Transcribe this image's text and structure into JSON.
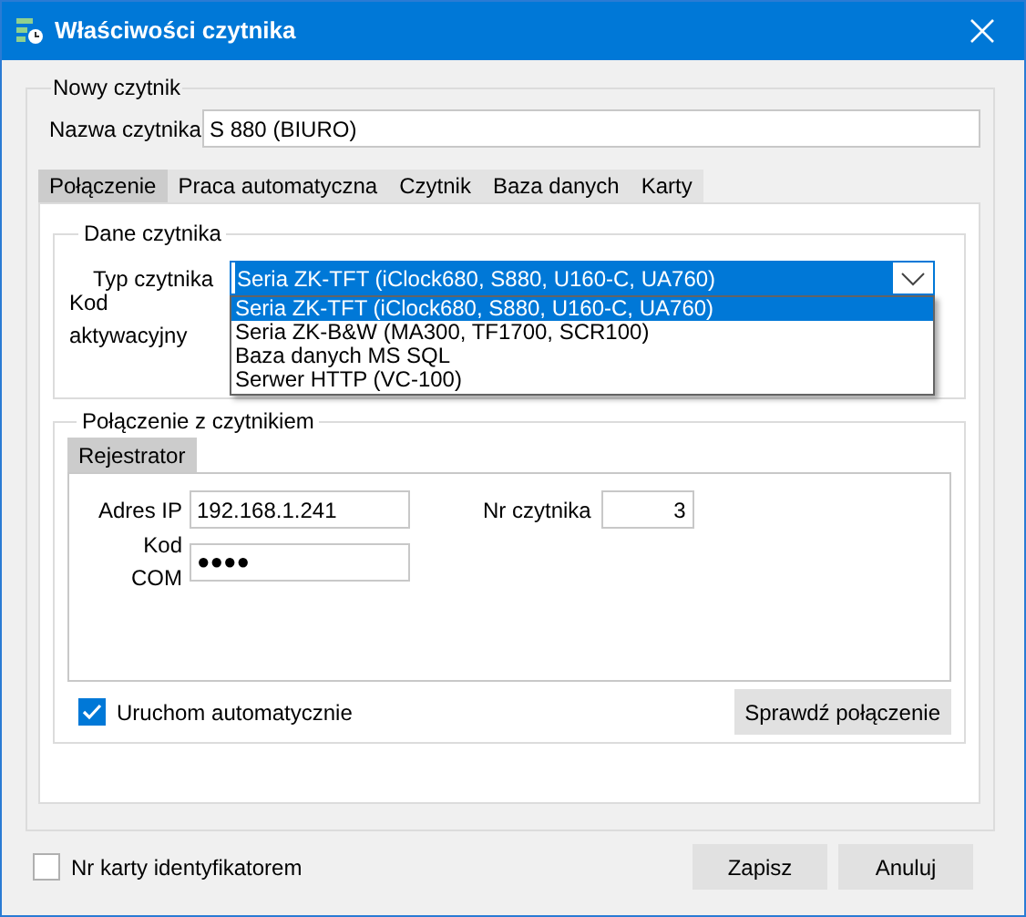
{
  "window": {
    "title": "Właściwości czytnika"
  },
  "group": {
    "legend": "Nowy czytnik",
    "name_label": "Nazwa czytnika",
    "name_value": "S 880 (BIURO)"
  },
  "tabs": [
    {
      "label": "Połączenie",
      "selected": true
    },
    {
      "label": "Praca automatyczna",
      "selected": false
    },
    {
      "label": "Czytnik",
      "selected": false
    },
    {
      "label": "Baza danych",
      "selected": false
    },
    {
      "label": "Karty",
      "selected": false
    }
  ],
  "reader_data": {
    "legend": "Dane czytnika",
    "type_label": "Typ czytnika",
    "type_value": "Seria ZK-TFT (iClock680, S880, U160-C, UA760)",
    "activation_label": "Kod aktywacyjny",
    "options": [
      {
        "label": "Seria ZK-TFT (iClock680, S880, U160-C, UA760)",
        "selected": true
      },
      {
        "label": "Seria ZK-B&W (MA300, TF1700, SCR100)",
        "selected": false
      },
      {
        "label": "Baza danych MS SQL",
        "selected": false
      },
      {
        "label": "Serwer HTTP (VC-100)",
        "selected": false
      }
    ]
  },
  "connection": {
    "legend": "Połączenie z czytnikiem",
    "tabs": [
      {
        "label": "Rejestrator",
        "selected": true
      }
    ],
    "ip_label": "Adres IP",
    "ip_value": "192.168.1.241",
    "com_label": "Kod COM",
    "com_value": "●●●●",
    "reader_no_label": "Nr czytnika",
    "reader_no_value": "3",
    "autostart": {
      "label": "Uruchom automatycznie",
      "checked": true
    },
    "test_button": "Sprawdź połączenie"
  },
  "card_id": {
    "label": "Nr karty identyfikatorem",
    "checked": false
  },
  "buttons": [
    "Zapisz",
    "Anuluj"
  ]
}
